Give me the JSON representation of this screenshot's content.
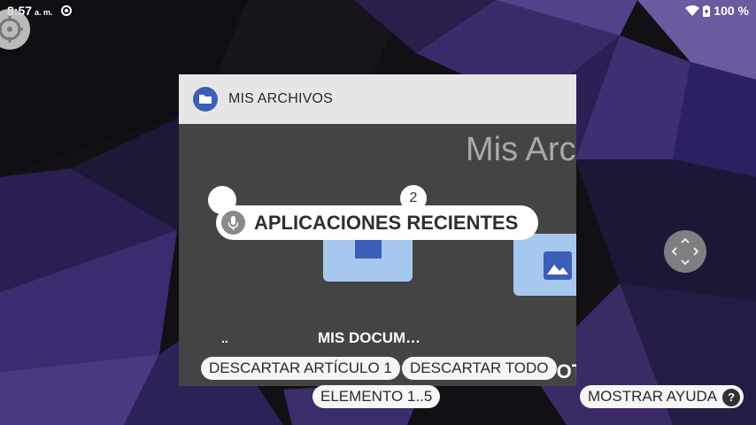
{
  "status_bar": {
    "time": "8:57",
    "ampm": "a. m.",
    "battery": "100 %",
    "icons": [
      "sync-icon",
      "wifi-icon",
      "battery-charging-icon"
    ]
  },
  "recent_card": {
    "app_title": "MIS ARCHIVOS",
    "app_icon": "folder-icon",
    "body_title": "Mis Arch",
    "badge_number": "2",
    "parent_label": "..",
    "documents_label": "MIS DOCUM…",
    "photos_label": "MIS FOT"
  },
  "voice_hint": {
    "label": "APLICACIONES RECIENTES",
    "icon": "mic-icon"
  },
  "chips": {
    "dismiss_one": "DESCARTAR ARTÍCULO 1",
    "dismiss_all": "DESCARTAR TODO",
    "element_range": "ELEMENTO 1..5",
    "show_help": "MOSTRAR AYUDA",
    "help_symbol": "?"
  },
  "colors": {
    "header_bg": "#e6e6e6",
    "card_bg": "#444444",
    "folder": "#a7c8ee",
    "app_icon": "#3b5fb8"
  }
}
